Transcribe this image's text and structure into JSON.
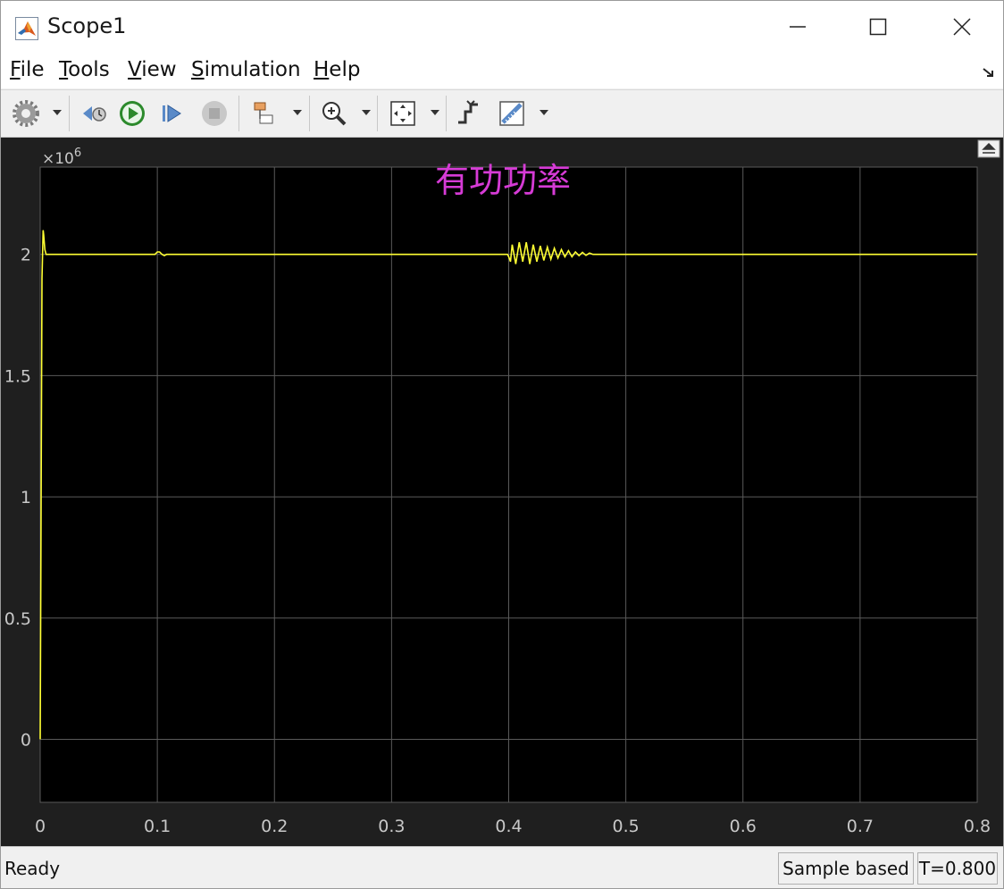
{
  "window": {
    "title": "Scope1",
    "app_icon": "matlab-logo-icon"
  },
  "menu": {
    "file": {
      "mnemonic": "F",
      "rest": "ile"
    },
    "tools": {
      "mnemonic": "T",
      "rest": "ools"
    },
    "view": {
      "mnemonic": "V",
      "rest": "iew"
    },
    "simulation": {
      "mnemonic": "S",
      "rest": "imulation"
    },
    "help": {
      "mnemonic": "H",
      "rest": "elp"
    }
  },
  "toolbar": {
    "icons": [
      "gear-icon",
      "step-back-icon",
      "run-icon",
      "step-forward-icon",
      "stop-icon",
      "highlight-block-icon",
      "zoom-icon",
      "autoscale-icon",
      "triggers-icon",
      "cursor-measurements-icon"
    ]
  },
  "colors": {
    "plot_bg": "#000000",
    "figure_bg": "#1f1f1f",
    "grid": "#5a5a5a",
    "trace": "#ffff33",
    "title": "#d63bd6",
    "tick_text": "#c8c8c8"
  },
  "chart_data": {
    "type": "line",
    "title": "有功功率",
    "y_multiplier": "×10",
    "y_exponent": "6",
    "xlim": [
      0,
      0.8
    ],
    "ylim": [
      -0.26,
      2.36
    ],
    "xticks": [
      0,
      0.1,
      0.2,
      0.3,
      0.4,
      0.5,
      0.6,
      0.7,
      0.8
    ],
    "xtick_labels": [
      "0",
      "0.1",
      "0.2",
      "0.3",
      "0.4",
      "0.5",
      "0.6",
      "0.7",
      "0.8"
    ],
    "yticks": [
      0,
      0.5,
      1,
      1.5,
      2
    ],
    "ytick_labels": [
      "0",
      "0.5",
      "1",
      "1.5",
      "2"
    ],
    "grid": true,
    "series": [
      {
        "color": "#ffff33",
        "x": [
          0,
          0.0015,
          0.0025,
          0.003,
          0.004,
          0.005,
          0.006,
          0.008,
          0.01,
          0.05,
          0.098,
          0.1,
          0.102,
          0.104,
          0.106,
          0.108,
          0.11,
          0.115,
          0.12,
          0.35,
          0.399,
          0.4,
          0.4015,
          0.403,
          0.406,
          0.409,
          0.412,
          0.415,
          0.418,
          0.421,
          0.424,
          0.427,
          0.43,
          0.433,
          0.436,
          0.439,
          0.442,
          0.445,
          0.448,
          0.451,
          0.454,
          0.457,
          0.46,
          0.463,
          0.466,
          0.469,
          0.472,
          0.48,
          0.6,
          0.8
        ],
        "y": [
          0,
          1.9,
          2.1,
          2.08,
          2.02,
          2.0,
          2.0,
          2.0,
          2.0,
          2.0,
          2.0,
          2.01,
          2.01,
          2.0,
          1.995,
          2.0,
          2.0,
          2.0,
          2.0,
          2.0,
          2.0,
          1.99,
          1.97,
          2.04,
          1.96,
          2.05,
          1.97,
          2.05,
          1.96,
          2.04,
          1.97,
          2.035,
          1.975,
          2.03,
          1.98,
          2.025,
          1.985,
          2.02,
          1.99,
          2.015,
          1.99,
          2.01,
          1.995,
          2.008,
          1.996,
          2.005,
          2.0,
          2.0,
          2.0,
          2.0
        ]
      }
    ]
  },
  "status": {
    "left": "Ready",
    "mode": "Sample based",
    "time": "T=0.800"
  }
}
